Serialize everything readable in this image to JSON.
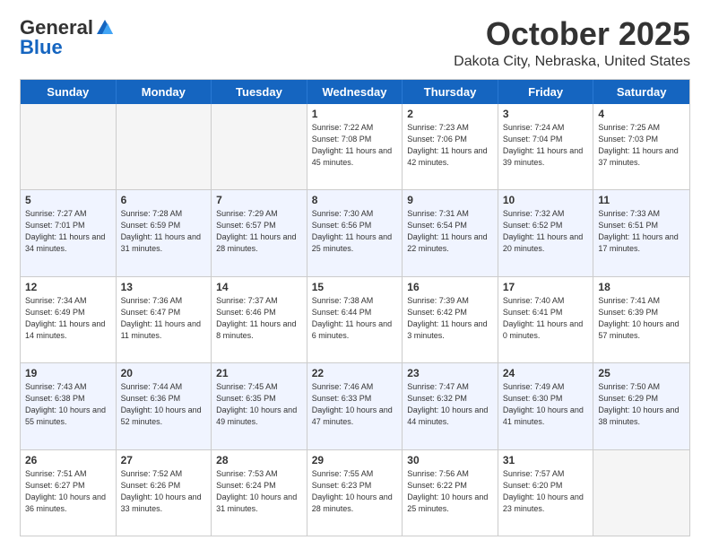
{
  "header": {
    "logo_general": "General",
    "logo_blue": "Blue",
    "month": "October 2025",
    "location": "Dakota City, Nebraska, United States"
  },
  "days_of_week": [
    "Sunday",
    "Monday",
    "Tuesday",
    "Wednesday",
    "Thursday",
    "Friday",
    "Saturday"
  ],
  "weeks": [
    [
      {
        "day": "",
        "info": ""
      },
      {
        "day": "",
        "info": ""
      },
      {
        "day": "",
        "info": ""
      },
      {
        "day": "1",
        "info": "Sunrise: 7:22 AM\nSunset: 7:08 PM\nDaylight: 11 hours and 45 minutes."
      },
      {
        "day": "2",
        "info": "Sunrise: 7:23 AM\nSunset: 7:06 PM\nDaylight: 11 hours and 42 minutes."
      },
      {
        "day": "3",
        "info": "Sunrise: 7:24 AM\nSunset: 7:04 PM\nDaylight: 11 hours and 39 minutes."
      },
      {
        "day": "4",
        "info": "Sunrise: 7:25 AM\nSunset: 7:03 PM\nDaylight: 11 hours and 37 minutes."
      }
    ],
    [
      {
        "day": "5",
        "info": "Sunrise: 7:27 AM\nSunset: 7:01 PM\nDaylight: 11 hours and 34 minutes."
      },
      {
        "day": "6",
        "info": "Sunrise: 7:28 AM\nSunset: 6:59 PM\nDaylight: 11 hours and 31 minutes."
      },
      {
        "day": "7",
        "info": "Sunrise: 7:29 AM\nSunset: 6:57 PM\nDaylight: 11 hours and 28 minutes."
      },
      {
        "day": "8",
        "info": "Sunrise: 7:30 AM\nSunset: 6:56 PM\nDaylight: 11 hours and 25 minutes."
      },
      {
        "day": "9",
        "info": "Sunrise: 7:31 AM\nSunset: 6:54 PM\nDaylight: 11 hours and 22 minutes."
      },
      {
        "day": "10",
        "info": "Sunrise: 7:32 AM\nSunset: 6:52 PM\nDaylight: 11 hours and 20 minutes."
      },
      {
        "day": "11",
        "info": "Sunrise: 7:33 AM\nSunset: 6:51 PM\nDaylight: 11 hours and 17 minutes."
      }
    ],
    [
      {
        "day": "12",
        "info": "Sunrise: 7:34 AM\nSunset: 6:49 PM\nDaylight: 11 hours and 14 minutes."
      },
      {
        "day": "13",
        "info": "Sunrise: 7:36 AM\nSunset: 6:47 PM\nDaylight: 11 hours and 11 minutes."
      },
      {
        "day": "14",
        "info": "Sunrise: 7:37 AM\nSunset: 6:46 PM\nDaylight: 11 hours and 8 minutes."
      },
      {
        "day": "15",
        "info": "Sunrise: 7:38 AM\nSunset: 6:44 PM\nDaylight: 11 hours and 6 minutes."
      },
      {
        "day": "16",
        "info": "Sunrise: 7:39 AM\nSunset: 6:42 PM\nDaylight: 11 hours and 3 minutes."
      },
      {
        "day": "17",
        "info": "Sunrise: 7:40 AM\nSunset: 6:41 PM\nDaylight: 11 hours and 0 minutes."
      },
      {
        "day": "18",
        "info": "Sunrise: 7:41 AM\nSunset: 6:39 PM\nDaylight: 10 hours and 57 minutes."
      }
    ],
    [
      {
        "day": "19",
        "info": "Sunrise: 7:43 AM\nSunset: 6:38 PM\nDaylight: 10 hours and 55 minutes."
      },
      {
        "day": "20",
        "info": "Sunrise: 7:44 AM\nSunset: 6:36 PM\nDaylight: 10 hours and 52 minutes."
      },
      {
        "day": "21",
        "info": "Sunrise: 7:45 AM\nSunset: 6:35 PM\nDaylight: 10 hours and 49 minutes."
      },
      {
        "day": "22",
        "info": "Sunrise: 7:46 AM\nSunset: 6:33 PM\nDaylight: 10 hours and 47 minutes."
      },
      {
        "day": "23",
        "info": "Sunrise: 7:47 AM\nSunset: 6:32 PM\nDaylight: 10 hours and 44 minutes."
      },
      {
        "day": "24",
        "info": "Sunrise: 7:49 AM\nSunset: 6:30 PM\nDaylight: 10 hours and 41 minutes."
      },
      {
        "day": "25",
        "info": "Sunrise: 7:50 AM\nSunset: 6:29 PM\nDaylight: 10 hours and 38 minutes."
      }
    ],
    [
      {
        "day": "26",
        "info": "Sunrise: 7:51 AM\nSunset: 6:27 PM\nDaylight: 10 hours and 36 minutes."
      },
      {
        "day": "27",
        "info": "Sunrise: 7:52 AM\nSunset: 6:26 PM\nDaylight: 10 hours and 33 minutes."
      },
      {
        "day": "28",
        "info": "Sunrise: 7:53 AM\nSunset: 6:24 PM\nDaylight: 10 hours and 31 minutes."
      },
      {
        "day": "29",
        "info": "Sunrise: 7:55 AM\nSunset: 6:23 PM\nDaylight: 10 hours and 28 minutes."
      },
      {
        "day": "30",
        "info": "Sunrise: 7:56 AM\nSunset: 6:22 PM\nDaylight: 10 hours and 25 minutes."
      },
      {
        "day": "31",
        "info": "Sunrise: 7:57 AM\nSunset: 6:20 PM\nDaylight: 10 hours and 23 minutes."
      },
      {
        "day": "",
        "info": ""
      }
    ]
  ]
}
